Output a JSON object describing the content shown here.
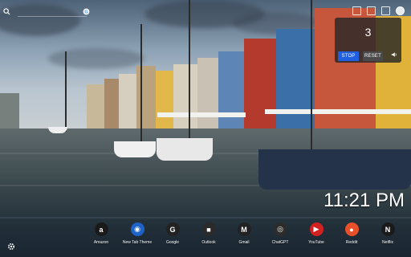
{
  "search": {
    "engine_icon": "google-icon"
  },
  "top_bar": {
    "icons": [
      "camera-icon",
      "fullscreen-icon",
      "notes-icon",
      "dark-icon"
    ]
  },
  "timer": {
    "value": "3",
    "stop_label": "STOP",
    "reset_label": "RESET",
    "sound_icon": "speaker-icon"
  },
  "clock": {
    "time": "11:21 PM"
  },
  "shortcuts": [
    {
      "label": "Amazon",
      "color": "#1a1a1a",
      "glyph": "a",
      "icon": "amazon-icon"
    },
    {
      "label": "New Tab Theme",
      "color": "#1e63c8",
      "glyph": "◉",
      "icon": "new-tab-theme-icon"
    },
    {
      "label": "Google",
      "color": "#222222",
      "glyph": "G",
      "icon": "google-icon"
    },
    {
      "label": "Outlook",
      "color": "#2a2a2a",
      "glyph": "■",
      "icon": "microsoft-icon"
    },
    {
      "label": "Gmail",
      "color": "#222222",
      "glyph": "M",
      "icon": "gmail-icon"
    },
    {
      "label": "ChatGPT",
      "color": "#2c2c2c",
      "glyph": "◎",
      "icon": "chatgpt-icon"
    },
    {
      "label": "YouTube",
      "color": "#d32020",
      "glyph": "▶",
      "icon": "youtube-icon"
    },
    {
      "label": "Reddit",
      "color": "#e8502a",
      "glyph": "●",
      "icon": "reddit-icon"
    },
    {
      "label": "Netflix",
      "color": "#1a1a1a",
      "glyph": "N",
      "icon": "netflix-icon"
    }
  ],
  "settings": {
    "icon": "gear-icon"
  },
  "colors": {
    "accent": "#1f5fe0",
    "widget_bg": "#282828"
  }
}
